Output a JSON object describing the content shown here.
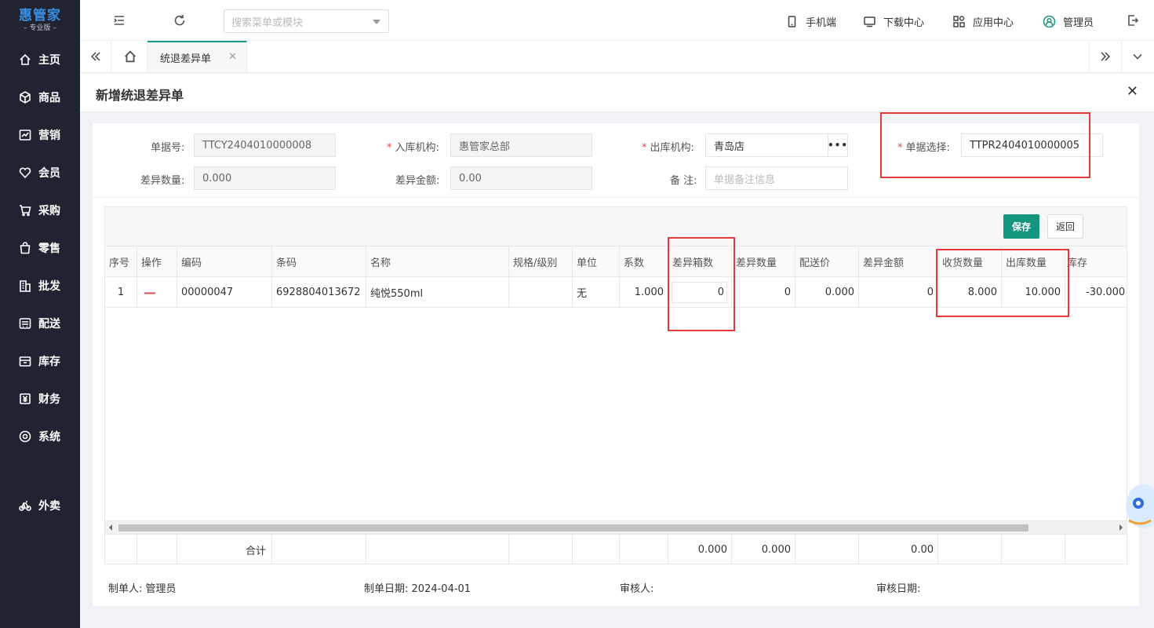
{
  "brand": {
    "name": "惠管家",
    "edition": "专业版"
  },
  "nav": [
    {
      "key": "home",
      "label": "主页",
      "icon": "home-icon"
    },
    {
      "key": "goods",
      "label": "商品",
      "icon": "box-icon"
    },
    {
      "key": "marketing",
      "label": "营销",
      "icon": "chart-icon"
    },
    {
      "key": "member",
      "label": "会员",
      "icon": "heart-icon"
    },
    {
      "key": "purchase",
      "label": "采购",
      "icon": "cart-icon"
    },
    {
      "key": "retail",
      "label": "零售",
      "icon": "bag-icon"
    },
    {
      "key": "wholesale",
      "label": "批发",
      "icon": "building-icon"
    },
    {
      "key": "distribution",
      "label": "配送",
      "icon": "truck-icon"
    },
    {
      "key": "inventory",
      "label": "库存",
      "icon": "archive-icon"
    },
    {
      "key": "finance",
      "label": "财务",
      "icon": "yen-icon"
    },
    {
      "key": "system",
      "label": "系统",
      "icon": "settings-icon"
    },
    {
      "key": "takeout",
      "label": "外卖",
      "icon": "bike-icon"
    }
  ],
  "topbar": {
    "search_placeholder": "搜索菜单或模块",
    "mobile": "手机端",
    "download": "下载中心",
    "apps": "应用中心",
    "user": "管理员"
  },
  "tabs": {
    "active": "统退差异单"
  },
  "panel": {
    "title": "新增统退差异单"
  },
  "form": {
    "doc_no_label": "单据号:",
    "doc_no": "TTCY2404010000008",
    "in_org_label": "入库机构:",
    "in_org": "惠管家总部",
    "out_org_label": "出库机构:",
    "out_org": "青岛店",
    "doc_select_label": "单据选择:",
    "doc_select": "TTPR2404010000005",
    "diff_qty_label": "差异数量:",
    "diff_qty": "0.000",
    "diff_amt_label": "差异金额:",
    "diff_amt": "0.00",
    "remark_label": "备 注:",
    "remark_placeholder": "单据备注信息"
  },
  "toolbar": {
    "save": "保存",
    "back": "返回"
  },
  "table": {
    "columns": [
      "序号",
      "操作",
      "编码",
      "条码",
      "名称",
      "规格/级别",
      "单位",
      "系数",
      "差异箱数",
      "差异数量",
      "配送价",
      "差异金额",
      "收货数量",
      "出库数量",
      "库存"
    ],
    "rows": [
      {
        "seq": "1",
        "op": "—",
        "code": "00000047",
        "barcode": "6928804013672",
        "name": "纯悦550ml",
        "spec": "",
        "unit": "无",
        "factor": "1.000",
        "diff_box": "0",
        "diff_qty": "0",
        "price": "0.000",
        "diff_amt": "0",
        "recv_qty": "8.000",
        "out_qty": "10.000",
        "stock": "-30.000"
      }
    ],
    "footer": {
      "label": "合计",
      "diff_box": "0.000",
      "diff_qty": "0.000",
      "diff_amt": "0.00"
    }
  },
  "meta": {
    "creator_label": "制单人:",
    "creator": "管理员",
    "date_label": "制单日期:",
    "date": "2024-04-01",
    "reviewer_label": "审核人:",
    "reviewer": "",
    "review_date_label": "审核日期:",
    "review_date": ""
  },
  "colors": {
    "sidebar": "#1f2430",
    "accent": "#13967d",
    "annotation": "#e23b3b",
    "required": "#e34d4d"
  }
}
